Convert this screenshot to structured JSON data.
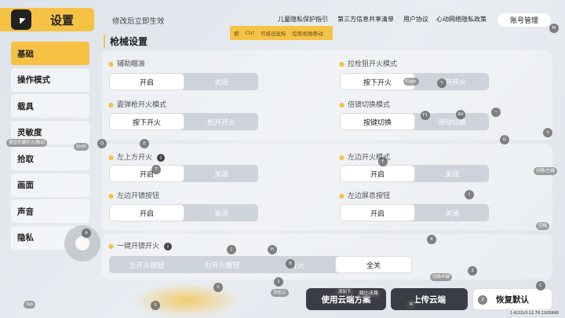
{
  "header": {
    "title": "设置",
    "notice": "修改后立即生效",
    "account_button": "账号管理"
  },
  "top_links": [
    "儿童隐私保护指引",
    "第三方信息共享清单",
    "用户协议",
    "心动网络隐私政策"
  ],
  "tip_banner": [
    "按",
    "Ctrl",
    "可挂出鼠标",
    "控制视角移动"
  ],
  "sidebar": {
    "items": [
      {
        "label": "基础",
        "active": true
      },
      {
        "label": "操作模式",
        "active": false
      },
      {
        "label": "载具",
        "active": false
      },
      {
        "label": "灵敏度",
        "active": false
      },
      {
        "label": "拾取",
        "active": false
      },
      {
        "label": "画面",
        "active": false
      },
      {
        "label": "声音",
        "active": false
      },
      {
        "label": "隐私",
        "active": false
      }
    ]
  },
  "main": {
    "section_title": "枪械设置",
    "options": {
      "aim_assist": {
        "label": "辅助瞄准",
        "left": "开启",
        "right": "关闭"
      },
      "bolt_fire": {
        "label": "拉栓狙开火模式",
        "left": "按下开火",
        "right": "松开开火"
      },
      "shotgun_fire": {
        "label": "霰弹枪开火模式",
        "left": "按下开火",
        "right": "松开开火"
      },
      "scope_switch": {
        "label": "倍镜切换模式",
        "left": "按键切换",
        "right": "滑动切换"
      },
      "top_left_fire": {
        "label": "左上方开火",
        "left": "开启",
        "right": "关闭"
      },
      "left_fire_mode": {
        "label": "左边开火模式",
        "left": "开启",
        "right": "关闭"
      },
      "left_scope_button": {
        "label": "左边开镜按钮",
        "left": "开启",
        "right": "关闭"
      },
      "left_hold_button": {
        "label": "左边屏息按钮",
        "left": "开启",
        "right": "关闭"
      },
      "one_key_scope_fire": {
        "label": "一键开镜开火",
        "options": [
          "左开火按钮",
          "右开火按钮",
          "开火",
          "全关"
        ]
      }
    }
  },
  "bottom": {
    "cloud_scheme": "使用云端方案",
    "upload_cloud": "上传云端",
    "restore_default": "恢复默认",
    "version": "1-6/22s3-12.76.1169848"
  },
  "key_hints": {
    "chips": [
      "按住左键开火/拖动",
      "Shift",
      "Caps",
      "切换/左键",
      "空格",
      "跳过/走路",
      "添加上",
      "添加下",
      "Tab",
      "切换中键"
    ],
    "circles": [
      "Q",
      "E",
      "T",
      "F1",
      "Alt",
      "Y",
      "G",
      "V",
      "J",
      "H",
      "B",
      "X",
      "S",
      "R",
      "Z",
      "C",
      "M",
      "I",
      "4",
      "1",
      "3",
      "~",
      "F",
      "A"
    ]
  },
  "colors": {
    "accent": "#f6c244",
    "dark_button": "#3a3d45"
  }
}
